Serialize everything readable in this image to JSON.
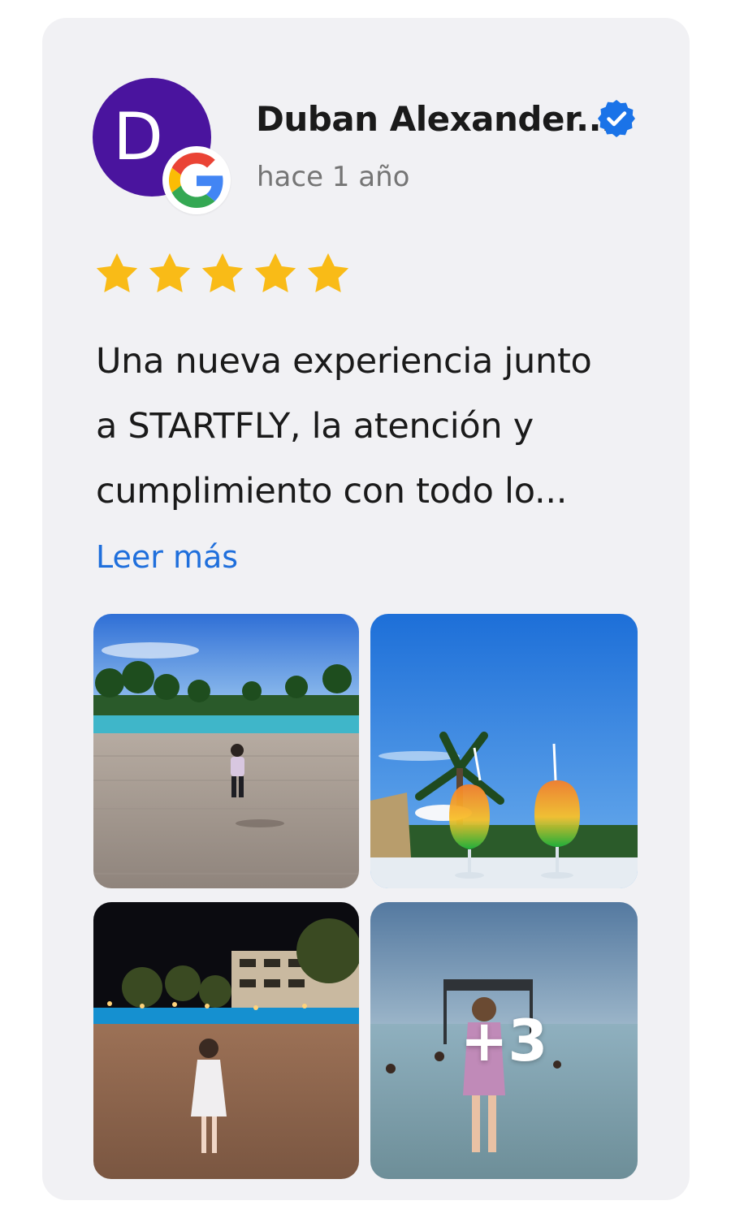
{
  "review": {
    "avatar_letter": "D",
    "author_name": "Duban Alexander...",
    "time_ago": "hace 1 año",
    "rating": 5,
    "rating_max": 5,
    "text_lines": [
      "Una nueva experiencia junto",
      "a STARTFLY, la atención y",
      "cumplimiento con todo lo..."
    ],
    "read_more_label": "Leer más",
    "photos": [
      {
        "subject": "child on pool deck with palm trees"
      },
      {
        "subject": "two tropical cocktails by the pool"
      },
      {
        "subject": "girl on plaza at night"
      },
      {
        "subject": "girl on the beach by swing sign"
      }
    ],
    "more_photos_label": "+3"
  },
  "colors": {
    "avatar_bg": "#4a149e",
    "verified_blue": "#1a73e8",
    "star_yellow": "#f9bb17",
    "link_blue": "#1f6fdc",
    "card_bg": "#f1f1f4"
  },
  "icons": {
    "source": "google-icon",
    "verified": "verified-check-icon",
    "rating": "star-icon"
  }
}
